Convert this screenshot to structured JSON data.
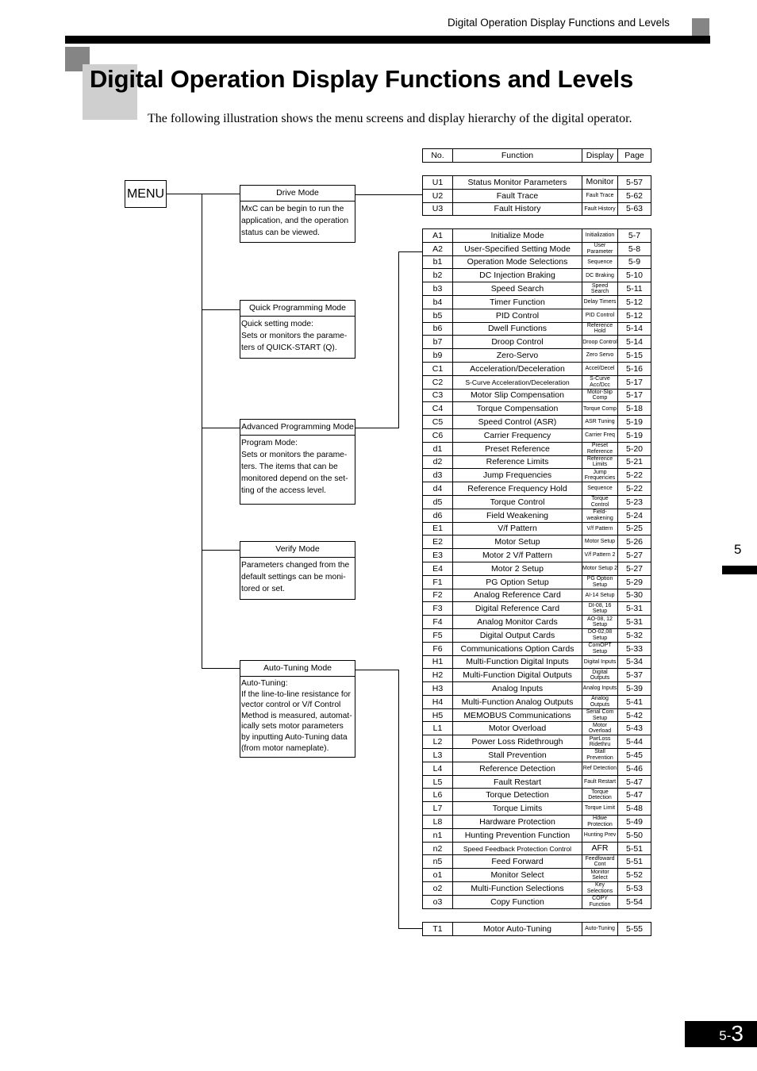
{
  "header": {
    "running_title": "Digital Operation Display Functions and Levels"
  },
  "page_title": "Digital Operation Display Functions and Levels",
  "intro_text": "The following illustration shows the menu screens and display hierarchy of the digital operator.",
  "menu_label": "MENU",
  "modes": [
    {
      "title": "Drive Mode",
      "description": "MxC can be begin to run the\napplication, and the operation\nstatus can be viewed."
    },
    {
      "title": "Quick Programming Mode",
      "description": "Quick setting mode:\nSets or monitors the parame-\nters of QUICK-START (Q)."
    },
    {
      "title": "Advanced Programming Mode",
      "description": "Program Mode:\nSets or monitors the parame-\nters. The items that can be\nmonitored depend on the set-\nting of the access level."
    },
    {
      "title": "Verify Mode",
      "description": "Parameters changed from the\ndefault settings can be moni-\ntored or set."
    },
    {
      "title": "Auto-Tuning Mode",
      "description": "Auto-Tuning:\nIf the line-to-line resistance for\nvector control or V/f Control\nMethod is measured, automat-\nically sets motor parameters\nby inputting Auto-Tuning data\n(from motor nameplate)."
    }
  ],
  "table_headers": {
    "no": "No.",
    "function": "Function",
    "display": "Display",
    "page": "Page"
  },
  "drive_params": [
    {
      "no": "U1",
      "function": "Status Monitor Parameters",
      "display": "Monitor",
      "page": "5-57"
    },
    {
      "no": "U2",
      "function": "Fault Trace",
      "display": "Fault Trace",
      "page": "5-62"
    },
    {
      "no": "U3",
      "function": "Fault History",
      "display": "Fault History",
      "page": "5-63"
    }
  ],
  "advanced_params": [
    {
      "no": "A1",
      "function": "Initialize Mode",
      "display": "Initialization",
      "page": "5-7"
    },
    {
      "no": "A2",
      "function": "User-Specified Setting Mode",
      "display": "User Parameter",
      "page": "5-8"
    },
    {
      "no": "b1",
      "function": "Operation Mode Selections",
      "display": "Sequence",
      "page": "5-9"
    },
    {
      "no": "b2",
      "function": "DC Injection Braking",
      "display": "DC Braking",
      "page": "5-10"
    },
    {
      "no": "b3",
      "function": "Speed Search",
      "display": "Speed Search",
      "page": "5-11"
    },
    {
      "no": "b4",
      "function": "Timer Function",
      "display": "Delay Timers",
      "page": "5-12"
    },
    {
      "no": "b5",
      "function": "PID Control",
      "display": "PID Control",
      "page": "5-12"
    },
    {
      "no": "b6",
      "function": "Dwell Functions",
      "display": "Reference Hold",
      "page": "5-14"
    },
    {
      "no": "b7",
      "function": "Droop Control",
      "display": "Droop Control",
      "page": "5-14"
    },
    {
      "no": "b9",
      "function": "Zero-Servo",
      "display": "Zero Servo",
      "page": "5-15"
    },
    {
      "no": "C1",
      "function": "Acceleration/Deceleration",
      "display": "Accel/Decel",
      "page": "5-16"
    },
    {
      "no": "C2",
      "function": "S-Curve Acceleration/Deceleration",
      "display": "S-Curve Acc/Dcc",
      "page": "5-17"
    },
    {
      "no": "C3",
      "function": "Motor Slip Compensation",
      "display": "Motor-Slip Comp",
      "page": "5-17"
    },
    {
      "no": "C4",
      "function": "Torque Compensation",
      "display": "Torque Comp",
      "page": "5-18"
    },
    {
      "no": "C5",
      "function": "Speed Control (ASR)",
      "display": "ASR Tuning",
      "page": "5-19"
    },
    {
      "no": "C6",
      "function": "Carrier Frequency",
      "display": "Carrier Freq",
      "page": "5-19"
    },
    {
      "no": "d1",
      "function": "Preset Reference",
      "display": "Preset Reference",
      "page": "5-20"
    },
    {
      "no": "d2",
      "function": "Reference Limits",
      "display": "Reference Limits",
      "page": "5-21"
    },
    {
      "no": "d3",
      "function": "Jump Frequencies",
      "display": "Jump Frequencies",
      "page": "5-22"
    },
    {
      "no": "d4",
      "function": "Reference Frequency Hold",
      "display": "Sequence",
      "page": "5-22"
    },
    {
      "no": "d5",
      "function": "Torque Control",
      "display": "Torque Control",
      "page": "5-23"
    },
    {
      "no": "d6",
      "function": "Field Weakening",
      "display": "Field-weakening",
      "page": "5-24"
    },
    {
      "no": "E1",
      "function": "V/f Pattern",
      "display": "V/f Pattern",
      "page": "5-25"
    },
    {
      "no": "E2",
      "function": "Motor Setup",
      "display": "Motor Setup",
      "page": "5-26"
    },
    {
      "no": "E3",
      "function": "Motor 2 V/f Pattern",
      "display": "V/f Pattern 2",
      "page": "5-27"
    },
    {
      "no": "E4",
      "function": "Motor 2 Setup",
      "display": "Motor Setup 2",
      "page": "5-27"
    },
    {
      "no": "F1",
      "function": "PG Option Setup",
      "display": "PG Option Setup",
      "page": "5-29"
    },
    {
      "no": "F2",
      "function": "Analog Reference Card",
      "display": "AI-14 Setup",
      "page": "5-30"
    },
    {
      "no": "F3",
      "function": "Digital Reference Card",
      "display": "DI-08, 16 Setup",
      "page": "5-31"
    },
    {
      "no": "F4",
      "function": "Analog Monitor Cards",
      "display": "AO-08, 12 Setup",
      "page": "5-31"
    },
    {
      "no": "F5",
      "function": "Digital Output Cards",
      "display": "DO-02,08 Setup",
      "page": "5-32"
    },
    {
      "no": "F6",
      "function": "Communications Option Cards",
      "display": "ComOPT Setup",
      "page": "5-33"
    },
    {
      "no": "H1",
      "function": "Multi-Function Digital Inputs",
      "display": "Digital Inputs",
      "page": "5-34"
    },
    {
      "no": "H2",
      "function": "Multi-Function Digital Outputs",
      "display": "Digital Outputs",
      "page": "5-37"
    },
    {
      "no": "H3",
      "function": "Analog Inputs",
      "display": "Analog Inputs",
      "page": "5-39"
    },
    {
      "no": "H4",
      "function": "Multi-Function Analog Outputs",
      "display": "Analog Outputs",
      "page": "5-41"
    },
    {
      "no": "H5",
      "function": "MEMOBUS Communications",
      "display": "Serial Com Setup",
      "page": "5-42"
    },
    {
      "no": "L1",
      "function": "Motor Overload",
      "display": "Motor Overload",
      "page": "5-43"
    },
    {
      "no": "L2",
      "function": "Power Loss Ridethrough",
      "display": "PwrLoss Ridethru",
      "page": "5-44"
    },
    {
      "no": "L3",
      "function": "Stall Prevention",
      "display": "Stall Prevention",
      "page": "5-45"
    },
    {
      "no": "L4",
      "function": "Reference Detection",
      "display": "Ref Detection",
      "page": "5-46"
    },
    {
      "no": "L5",
      "function": "Fault Restart",
      "display": "Fault Restart",
      "page": "5-47"
    },
    {
      "no": "L6",
      "function": "Torque Detection",
      "display": "Torque Detection",
      "page": "5-47"
    },
    {
      "no": "L7",
      "function": "Torque Limits",
      "display": "Torque Limit",
      "page": "5-48"
    },
    {
      "no": "L8",
      "function": "Hardware Protection",
      "display": "Hdwe Protection",
      "page": "5-49"
    },
    {
      "no": "n1",
      "function": "Hunting Prevention Function",
      "display": "Hunting Prev",
      "page": "5-50"
    },
    {
      "no": "n2",
      "function": "Speed Feedback Protection Control",
      "display": "AFR",
      "page": "5-51"
    },
    {
      "no": "n5",
      "function": "Feed Forward",
      "display": "Feedfoward Cont",
      "page": "5-51"
    },
    {
      "no": "o1",
      "function": "Monitor Select",
      "display": "Monitor Select",
      "page": "5-52"
    },
    {
      "no": "o2",
      "function": "Multi-Function Selections",
      "display": "Key Selections",
      "page": "5-53"
    },
    {
      "no": "o3",
      "function": "Copy Function",
      "display": "COPY Function",
      "page": "5-54"
    }
  ],
  "autotuning_params": [
    {
      "no": "T1",
      "function": "Motor Auto-Tuning",
      "display": "Auto-Tuning",
      "page": "5-55"
    }
  ],
  "chapter_tab": "5",
  "page_number": {
    "prefix": "5-",
    "number": "3"
  }
}
